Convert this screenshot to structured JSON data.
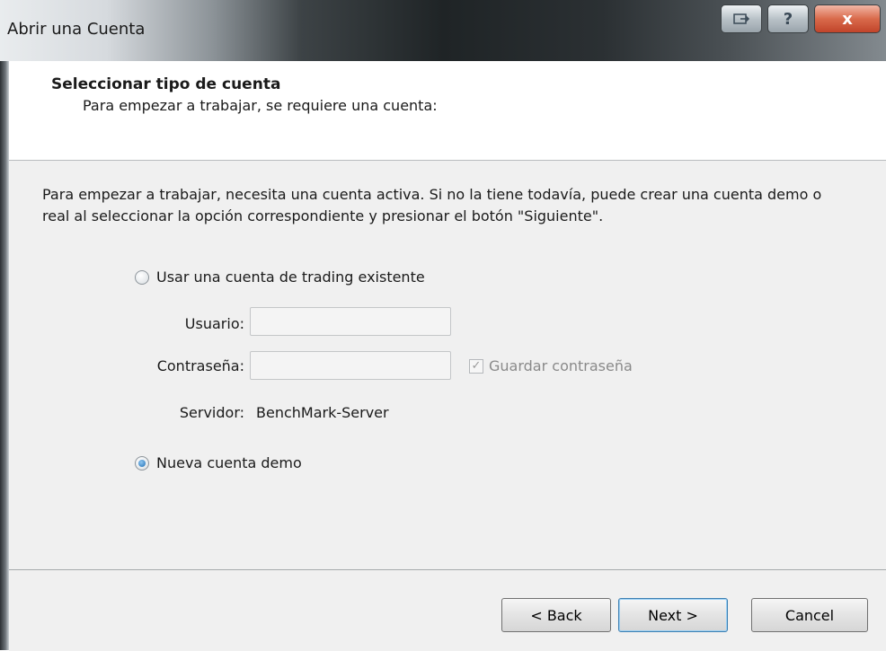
{
  "window": {
    "title": "Abrir una Cuenta",
    "controls": {
      "restore_icon": "restore-icon",
      "help_label": "?",
      "close_label": "x"
    }
  },
  "header": {
    "title": "Seleccionar tipo de cuenta",
    "subtitle": "Para empezar a trabajar, se requiere una cuenta:"
  },
  "body": {
    "intro": "Para empezar a trabajar, necesita una cuenta activa. Si no la tiene todavía, puede crear una cuenta demo o real al seleccionar la opción correspondiente y presionar el botón \"Siguiente\".",
    "options": {
      "existing": {
        "label": "Usar una cuenta de trading existente",
        "selected": false
      },
      "demo": {
        "label": "Nueva cuenta demo",
        "selected": true
      }
    },
    "fields": {
      "user_label": "Usuario:",
      "user_value": "",
      "password_label": "Contraseña:",
      "password_value": "",
      "save_password_label": "Guardar contraseña",
      "save_password_checked": true,
      "server_label": "Servidor:",
      "server_value": "BenchMark-Server"
    }
  },
  "footer": {
    "back_label": "< Back",
    "next_label": "Next >",
    "cancel_label": "Cancel"
  },
  "colors": {
    "accent": "#3c7fb1",
    "close_button": "#d96a4b"
  }
}
